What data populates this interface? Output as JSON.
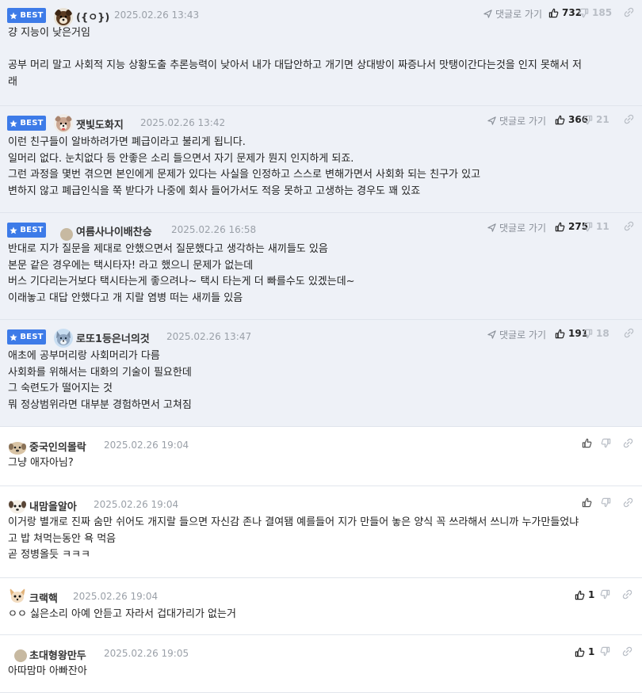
{
  "best_label": "BEST",
  "reply_label": "댓글로 가기",
  "comments": [
    {
      "nick": "({ㅇ})",
      "date": "2025.02.26 13:43",
      "up": "732",
      "down": "185",
      "lines": [
        "걍 지능이 낮은거임",
        "",
        "공부 머리 말고 사회적 지능 상황도출 추론능력이 낮아서 내가 대답안하고 개기면 상대방이 짜증나서 맛탱이간다는것을 인지 못해서 저",
        "래"
      ]
    },
    {
      "nick": "잿빛도화지",
      "date": "2025.02.26 13:42",
      "up": "366",
      "down": "21",
      "lines": [
        "이런 친구들이 알바하려가면 폐급이라고 불리게 됩니다.",
        "일머리 없다. 눈치없다 등 안좋은 소리 들으면서 자기 문제가 뭔지 인지하게 되죠.",
        "그런 과정을 몇번 겪으면 본인에게 문제가 있다는 사실을 인정하고 스스로 변해가면서 사회화 되는 친구가 있고",
        "변하지 않고 폐급인식을 쭉 받다가 나중에 회사 들어가서도 적응 못하고 고생하는 경우도 꽤 있죠"
      ]
    },
    {
      "nick": "여름사나이배찬승",
      "date": "2025.02.26 16:58",
      "up": "275",
      "down": "11",
      "lines": [
        "반대로 지가 질문을 제대로 안했으면서 질문했다고 생각하는 새끼들도 있음",
        "본문 같은 경우에는 택시타자! 라고 했으니 문제가 없는데",
        "버스 기다리는거보다 택시타는게 좋으려나~ 택시 타는게 더 빠를수도 있겠는데~",
        "이래놓고 대답 안했다고 개 지랄 염병 떠는 새끼들 있음"
      ]
    },
    {
      "nick": "로또1등은너의것",
      "date": "2025.02.26 13:47",
      "up": "191",
      "down": "18",
      "lines": [
        "애초에 공부머리랑 사회머리가 다름",
        "사회화를 위해서는 대화의 기술이 필요한데",
        "그 숙련도가 떨어지는 것",
        "뭐 정상범위라면 대부분 경험하면서 고쳐짐"
      ]
    },
    {
      "nick": "중국인의몰락",
      "date": "2025.02.26 19:04",
      "up": "",
      "down": "",
      "lines": [
        "그냥 애자아님?"
      ]
    },
    {
      "nick": "내맘을알아",
      "date": "2025.02.26 19:04",
      "up": "",
      "down": "",
      "lines": [
        "이거랑 별개로 진짜 숨만 쉬어도 개지랄 들으면 자신감 존나 결여됌 예를들어 지가 만들어 놓은 양식 꼭 쓰라해서 쓰니까 누가만들었냐",
        "고 밥 쳐먹는동안 욕 먹음",
        "곧 정병올듯 ㅋㅋㅋ"
      ]
    },
    {
      "nick": "크랙핵",
      "date": "2025.02.26 19:04",
      "up": "1",
      "down": "",
      "lines": [
        "ㅇㅇ 싫은소리 아예 안듣고 자라서 겁대가리가 없는거"
      ]
    },
    {
      "nick": "초대형왕만두",
      "date": "2025.02.26 19:05",
      "up": "1",
      "down": "",
      "lines": [
        "아따맘마 아빠잔아"
      ]
    }
  ]
}
